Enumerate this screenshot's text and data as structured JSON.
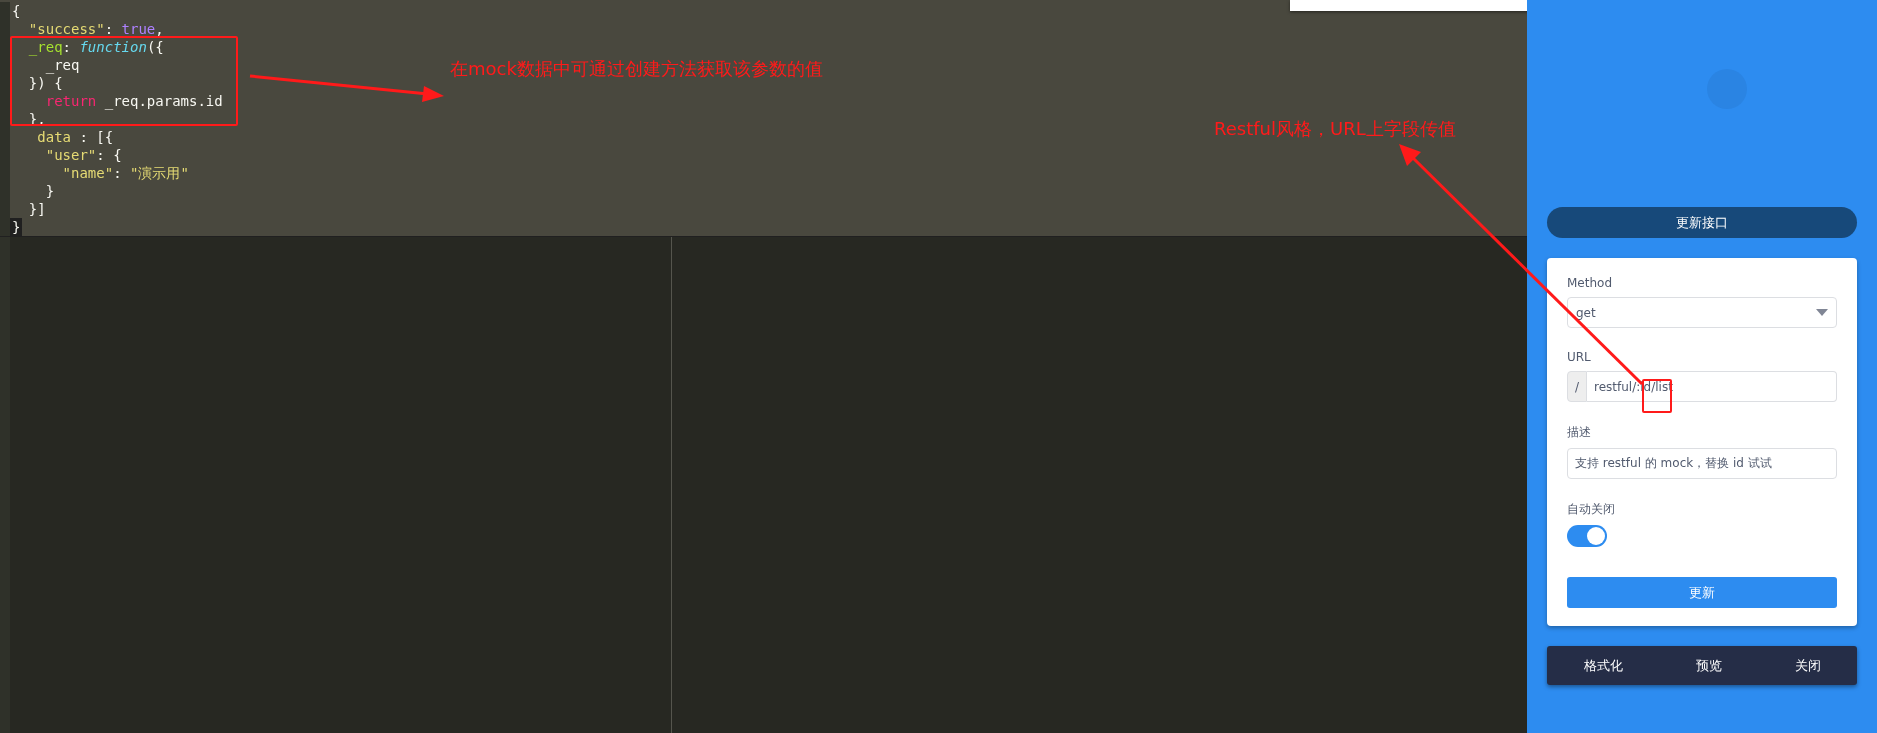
{
  "editor": {
    "lines": [
      [
        {
          "kind": "punct",
          "text": "{"
        }
      ],
      [
        {
          "kind": "str",
          "text": "  \"success\""
        },
        {
          "kind": "punct",
          "text": ": "
        },
        {
          "kind": "bool",
          "text": "true"
        },
        {
          "kind": "punct",
          "text": ","
        }
      ],
      [
        {
          "kind": "prop",
          "text": "  _req"
        },
        {
          "kind": "punct",
          "text": ": "
        },
        {
          "kind": "func",
          "text": "function"
        },
        {
          "kind": "punct",
          "text": "({"
        }
      ],
      [
        {
          "kind": "punct",
          "text": "    _req"
        }
      ],
      [
        {
          "kind": "punct",
          "text": "  }) {"
        }
      ],
      [
        {
          "kind": "kw",
          "text": "    return"
        },
        {
          "kind": "punct",
          "text": " _req.params.id"
        }
      ],
      [
        {
          "kind": "punct",
          "text": "  },"
        }
      ],
      [
        {
          "kind": "str",
          "text": "   data"
        },
        {
          "kind": "punct",
          "text": " : [{"
        }
      ],
      [
        {
          "kind": "str",
          "text": "    \"user\""
        },
        {
          "kind": "punct",
          "text": ": {"
        }
      ],
      [
        {
          "kind": "str",
          "text": "      \"name\""
        },
        {
          "kind": "punct",
          "text": ": "
        },
        {
          "kind": "str",
          "text": "\"演示用\""
        }
      ],
      [
        {
          "kind": "punct",
          "text": "    }"
        }
      ],
      [
        {
          "kind": "punct",
          "text": "  }]"
        }
      ],
      [
        {
          "kind": "punct",
          "text": "}"
        }
      ]
    ]
  },
  "annotations": [
    "在mock数据中可通过创建方法获取该参数的值",
    "Restful风格，URL上字段传值"
  ],
  "panel": {
    "title_button": "更新接口",
    "form": {
      "method_label": "Method",
      "method_value": "get",
      "url_label": "URL",
      "url_prefix": "/",
      "url_value": "restful/:id/list",
      "desc_label": "描述",
      "desc_value": "支持 restful 的 mock，替换 id 试试",
      "auto_close_label": "自动关闭",
      "auto_close": {
        "on": true
      },
      "submit": "更新"
    },
    "footer": [
      "格式化",
      "预览",
      "关闭"
    ]
  }
}
